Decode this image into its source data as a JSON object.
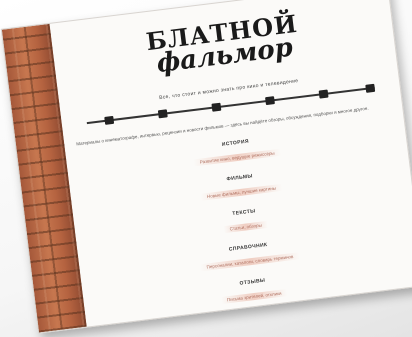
{
  "logo": {
    "line1": "БЛАТНОЙ",
    "line2": "фальмор"
  },
  "tagline": "Все, что стоит и можно знать про кино и телевидение",
  "intro": "Материалы о кинематографе, интервью, рецензии и новости фильмов — здесь вы найдёте обзоры, обсуждения, подборки и многое другое.",
  "sections": [
    {
      "title": "ИСТОРИЯ",
      "link": "Развитие кино, ведущие режиссёры"
    },
    {
      "title": "ФИЛЬМЫ",
      "link": "Новые фильмы, лучшие картины"
    },
    {
      "title": "ТЕКСТЫ",
      "link": "Статьи, обзоры"
    },
    {
      "title": "СПРАВОЧНИК",
      "link": "Персоналии, каталоги, словарь терминов"
    },
    {
      "title": "ОТЗЫВЫ",
      "link": "Письма зрителей, отклики"
    }
  ],
  "colors": {
    "brick": "#b56340",
    "page": "#fbfaf8",
    "link_highlight": "#e6aa96"
  }
}
